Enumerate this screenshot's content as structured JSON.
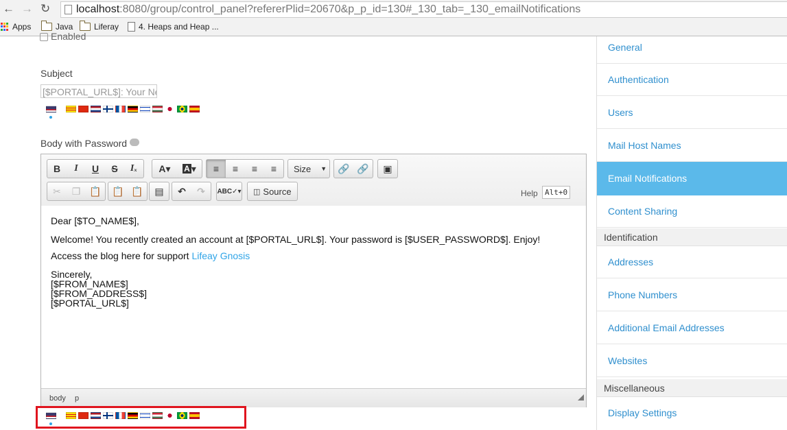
{
  "browser": {
    "url_host": "localhost",
    "url_rest": ":8080/group/control_panel?refererPlid=20670&p_p_id=130#_130_tab=_130_emailNotifications",
    "bookmarks": [
      "Apps",
      "Java",
      "Liferay",
      "4. Heaps and Heap ..."
    ]
  },
  "form": {
    "enabled_label": "Enabled",
    "subject_label": "Subject",
    "subject_value": "[$PORTAL_URL$]: Your New Account",
    "body_label": "Body with Password"
  },
  "editor": {
    "size_label": "Size",
    "source_label": "Source",
    "help_label": "Help",
    "help_shortcut": "Alt+0",
    "lines": {
      "greeting": "Dear [$TO_NAME$],",
      "welcome": "Welcome! You recently created an account at [$PORTAL_URL$]. Your password is [$USER_PASSWORD$]. Enjoy!",
      "access_prefix": "Access the blog here for support ",
      "access_link": "Lifeay Gnosis",
      "sincerely": "Sincerely,",
      "from_name": "[$FROM_NAME$]",
      "from_address": "[$FROM_ADDRESS$]",
      "portal_url": "[$PORTAL_URL$]"
    },
    "path": [
      "body",
      "p"
    ]
  },
  "flags": [
    "us",
    "ca",
    "cn",
    "nl",
    "fi",
    "fr",
    "de",
    "il",
    "hu",
    "jp",
    "br",
    "es"
  ],
  "sidebar": {
    "items": [
      {
        "label": "General"
      },
      {
        "label": "Authentication"
      },
      {
        "label": "Users"
      },
      {
        "label": "Mail Host Names"
      },
      {
        "label": "Email Notifications",
        "active": true
      },
      {
        "label": "Content Sharing"
      }
    ],
    "identification_header": "Identification",
    "identification_items": [
      {
        "label": "Addresses"
      },
      {
        "label": "Phone Numbers"
      },
      {
        "label": "Additional Email Addresses"
      },
      {
        "label": "Websites"
      }
    ],
    "misc_header": "Miscellaneous",
    "misc_items": [
      {
        "label": "Display Settings"
      }
    ]
  },
  "colors": {
    "accent": "#2fa4e7",
    "active_bg": "#5bb9ea",
    "highlight": "#e0141e"
  }
}
